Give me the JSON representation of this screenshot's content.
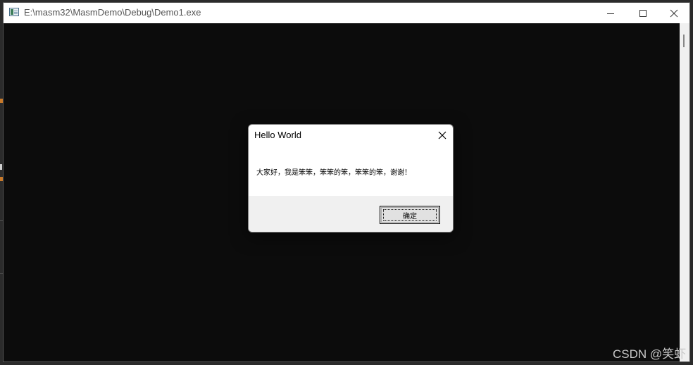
{
  "window": {
    "title": "E:\\masm32\\MasmDemo\\Debug\\Demo1.exe",
    "icon": "console-app-icon",
    "controls": [
      "minimize-icon",
      "maximize-icon",
      "close-icon"
    ]
  },
  "console": {
    "background": "#0c0c0c",
    "scrollbar_background": "#f0f0f0"
  },
  "message_box": {
    "title": "Hello World",
    "text": "大家好，我是笨笨，笨笨的笨，笨笨的笨，谢谢！",
    "ok_label": "确定",
    "close_icon": "close-icon"
  },
  "watermark": {
    "text": "CSDN @笑虾"
  }
}
